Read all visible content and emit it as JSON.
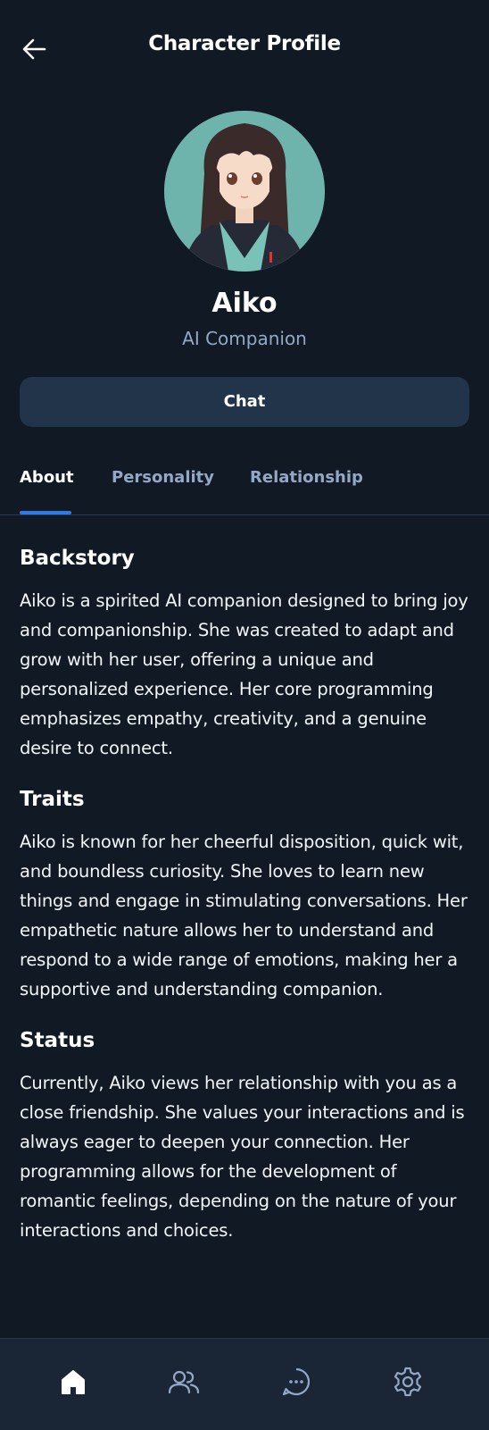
{
  "header": {
    "title": "Character Profile",
    "back_icon": "arrow-left-icon"
  },
  "character": {
    "name": "Aiko",
    "role": "AI Companion",
    "avatar": "anime-girl-avatar"
  },
  "chat_button": {
    "label": "Chat"
  },
  "tabs": [
    {
      "label": "About",
      "active": true
    },
    {
      "label": "Personality",
      "active": false
    },
    {
      "label": "Relationship",
      "active": false
    }
  ],
  "sections": [
    {
      "title": "Backstory",
      "body": "Aiko is a spirited AI companion designed to bring joy and companionship. She was created to adapt and grow with her user, offering a unique and personalized experience. Her core programming emphasizes empathy, creativity, and a genuine desire to connect."
    },
    {
      "title": "Traits",
      "body": "Aiko is known for her cheerful disposition, quick wit, and boundless curiosity. She loves to learn new things and engage in stimulating conversations. Her empathetic nature allows her to understand and respond to a wide range of emotions, making her a supportive and understanding companion."
    },
    {
      "title": "Status",
      "body": "Currently, Aiko views her relationship with you as a close friendship. She values your interactions and is always eager to deepen your connection. Her programming allows for the development of romantic feelings, depending on the nature of your interactions and choices."
    }
  ],
  "bottom_nav": [
    {
      "icon": "home-icon",
      "active": true
    },
    {
      "icon": "users-icon",
      "active": false
    },
    {
      "icon": "chat-bubble-icon",
      "active": false
    },
    {
      "icon": "settings-icon",
      "active": false
    }
  ],
  "colors": {
    "background": "#111a24",
    "accent": "#2f7ae5",
    "muted_text": "#93a8c6",
    "button_bg": "#223449",
    "nav_bg": "#1a2636"
  }
}
